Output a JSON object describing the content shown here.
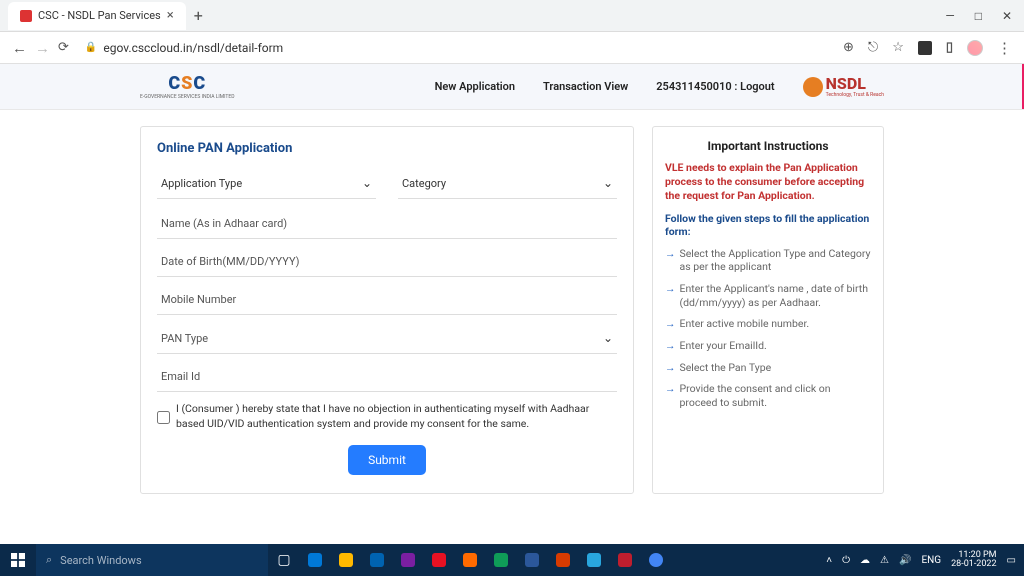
{
  "browser": {
    "tab_title": "CSC - NSDL Pan Services",
    "url": "egov.csccloud.in/nsdl/detail-form"
  },
  "nav": {
    "new_app": "New Application",
    "txn": "Transaction View",
    "logout": "254311450010 : Logout"
  },
  "form": {
    "title": "Online PAN Application",
    "app_type": "Application Type",
    "category": "Category",
    "name": "Name (As in Adhaar card)",
    "dob": "Date of Birth(MM/DD/YYYY)",
    "mobile": "Mobile Number",
    "pan_type": "PAN Type",
    "email": "Email Id",
    "consent": "I (Consumer ) hereby state that I have no objection in authenticating myself with Aadhaar based UID/VID authentication system and provide my consent for the same.",
    "submit": "Submit"
  },
  "instr": {
    "title": "Important Instructions",
    "red": "VLE needs to explain the Pan Application process to the consumer before accepting the request for Pan Application.",
    "blue": "Follow the given steps to fill the application form:",
    "s1": "Select the Application Type and Category as per the applicant",
    "s2": "Enter the Applicant's name , date of birth (dd/mm/yyyy) as per Aadhaar.",
    "s3": "Enter active mobile number.",
    "s4": "Enter your EmailId.",
    "s5": "Select the Pan Type",
    "s6": "Provide the consent and click on proceed to submit."
  },
  "taskbar": {
    "search_placeholder": "Search Windows",
    "lang": "ENG",
    "time": "11:20 PM",
    "date": "28-01-2022"
  }
}
